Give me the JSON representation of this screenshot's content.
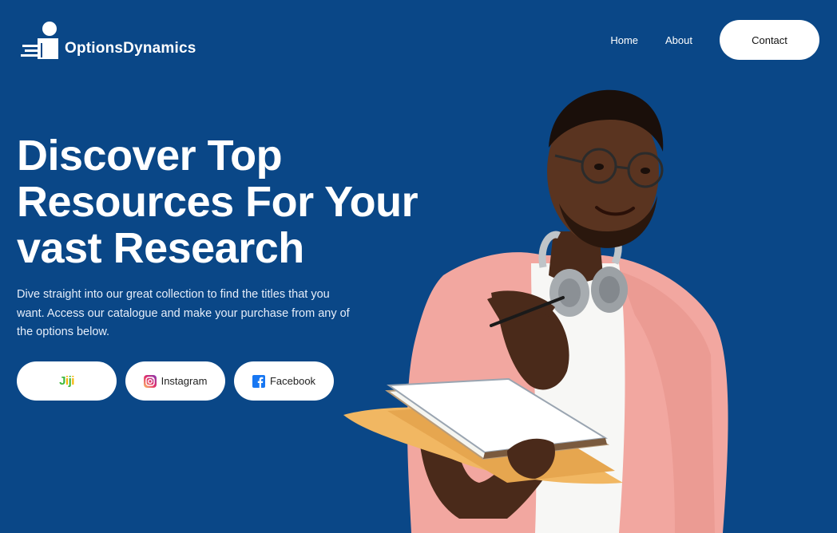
{
  "brand": {
    "name": "OptionsDynamics",
    "logo_icon": "reader-on-books-icon"
  },
  "nav": {
    "items": [
      {
        "label": "Home"
      },
      {
        "label": "About"
      }
    ],
    "contact_label": "Contact"
  },
  "hero": {
    "headline_lines": [
      "Discover Top",
      "Resources For Your",
      "vast Research"
    ],
    "description": "Dive straight into our great collection to find the titles that you want. Access our catalogue and make your purchase from any of the options below.",
    "image_alt": "Smiling student with glasses and headphones holding books and folders, pointing a pen"
  },
  "store_buttons": [
    {
      "label": "Jiji",
      "icon": "jiji-logo"
    },
    {
      "label": "Instagram",
      "icon": "instagram-icon"
    },
    {
      "label": "Facebook",
      "icon": "facebook-icon"
    }
  ],
  "colors": {
    "background": "#0a4787",
    "button_bg": "#ffffff",
    "text": "#ffffff",
    "jiji_green": "#3db83a",
    "jiji_yellow": "#f4b400",
    "facebook_blue": "#1877f2"
  }
}
